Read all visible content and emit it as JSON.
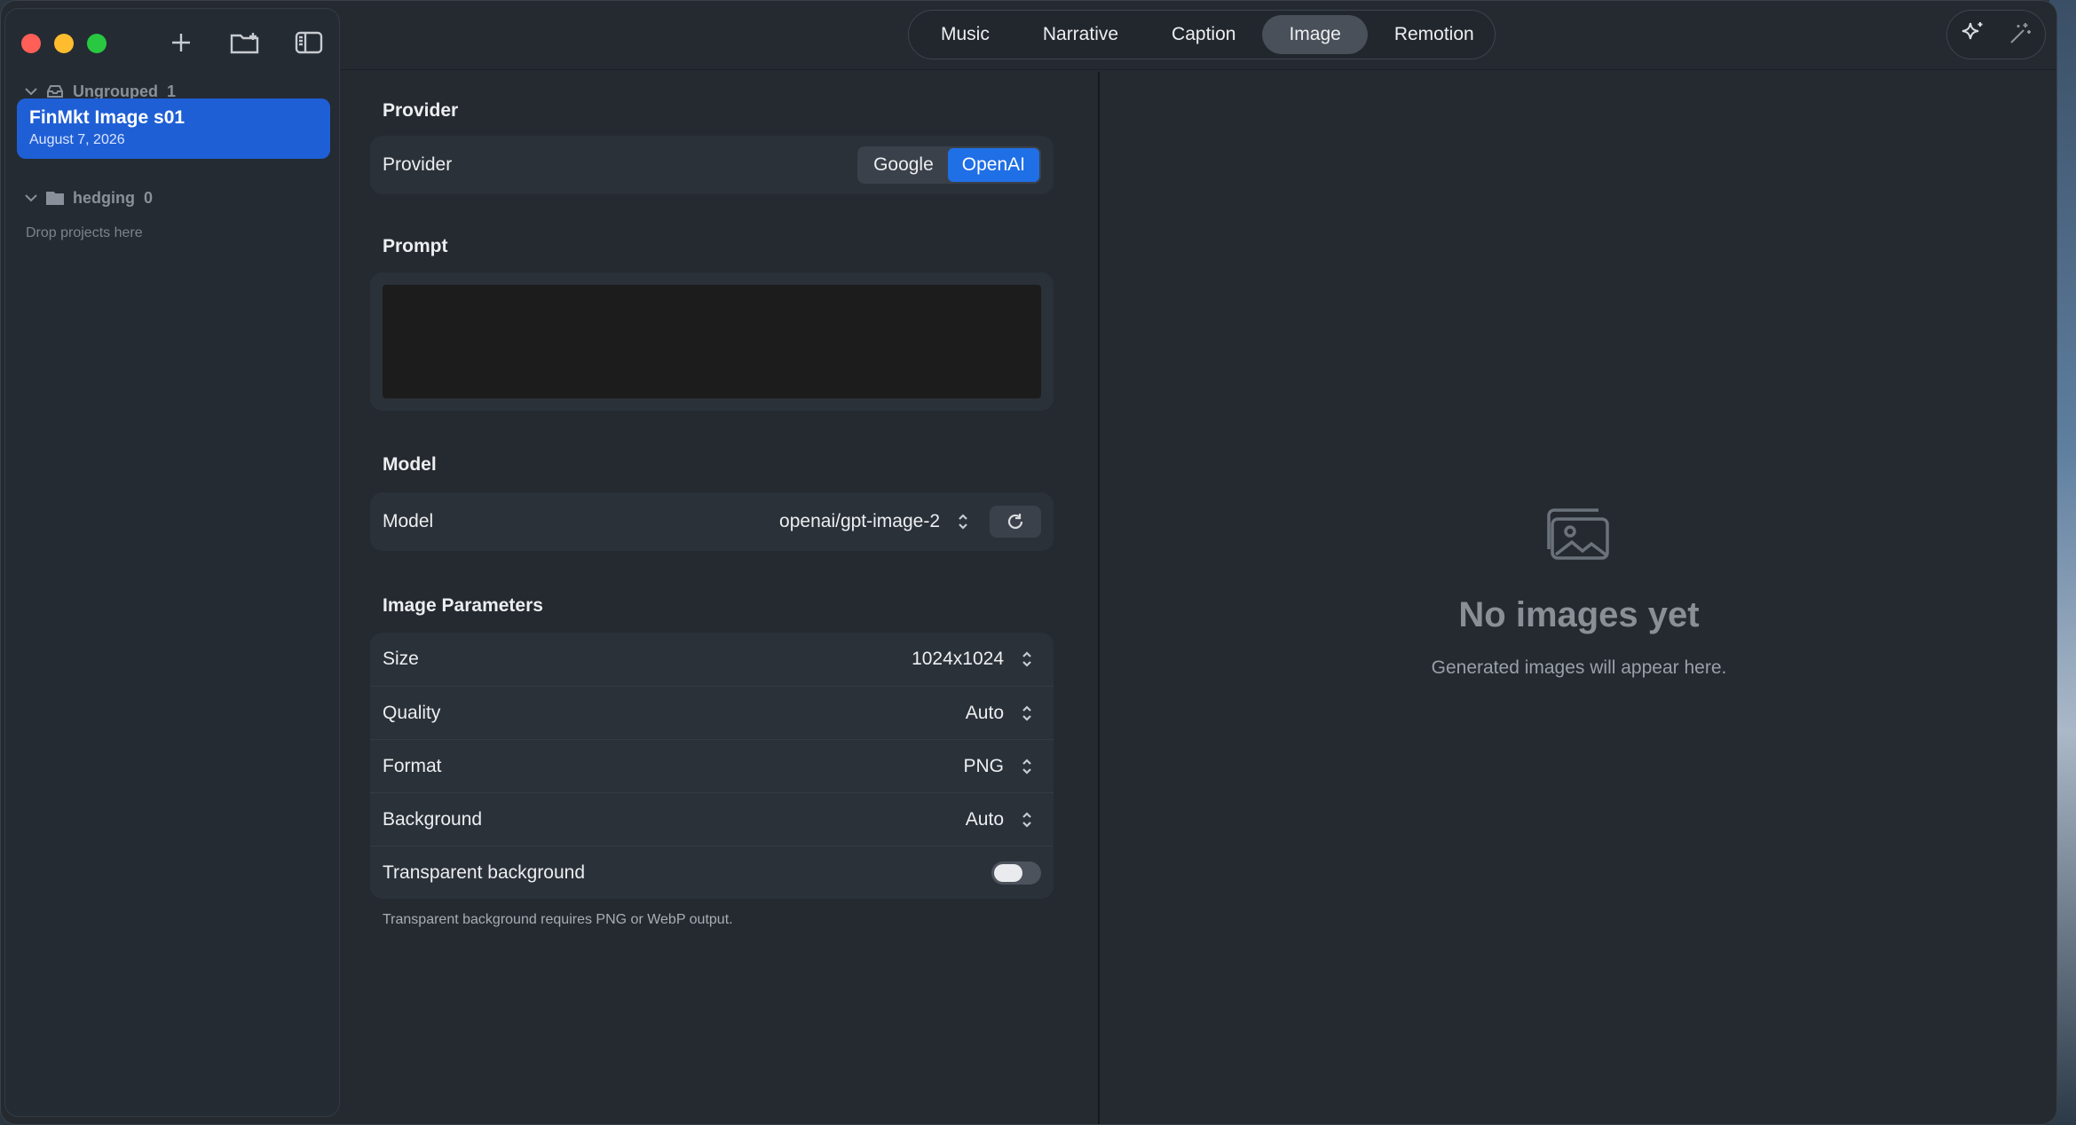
{
  "sidebar": {
    "groups": [
      {
        "name": "Ungrouped",
        "count": "1"
      },
      {
        "name": "hedging",
        "count": "0"
      }
    ],
    "project": {
      "title": "FinMkt Image s01",
      "date": "August 7, 2026"
    },
    "drop_hint": "Drop projects here"
  },
  "tabs": [
    {
      "label": "Music"
    },
    {
      "label": "Narrative"
    },
    {
      "label": "Caption"
    },
    {
      "label": "Image",
      "active": true
    },
    {
      "label": "Remotion"
    }
  ],
  "provider": {
    "section_title": "Provider",
    "row_label": "Provider",
    "options": [
      "Google",
      "OpenAI"
    ],
    "selected": "OpenAI"
  },
  "prompt": {
    "section_title": "Prompt",
    "value": ""
  },
  "model": {
    "section_title": "Model",
    "row_label": "Model",
    "value": "openai/gpt-image-2"
  },
  "image_params": {
    "section_title": "Image Parameters",
    "size": {
      "label": "Size",
      "value": "1024x1024"
    },
    "quality": {
      "label": "Quality",
      "value": "Auto"
    },
    "format": {
      "label": "Format",
      "value": "PNG"
    },
    "background": {
      "label": "Background",
      "value": "Auto"
    },
    "transparent": {
      "label": "Transparent background",
      "on": false
    },
    "hint": "Transparent background requires PNG or WebP output."
  },
  "empty_state": {
    "title": "No images yet",
    "subtitle": "Generated images will appear here."
  },
  "colors": {
    "accent": "#1f6fe6",
    "selected_project": "#1f5fd6",
    "traffic_red": "#ff5f57",
    "traffic_yellow": "#febc2e",
    "traffic_green": "#28c840"
  },
  "icons": [
    "plus-icon",
    "new-folder-icon",
    "sidebar-toggle-icon",
    "sparkle-icon",
    "magic-wand-icon",
    "refresh-icon",
    "chevron-up-down-icon",
    "photo-stack-icon"
  ]
}
